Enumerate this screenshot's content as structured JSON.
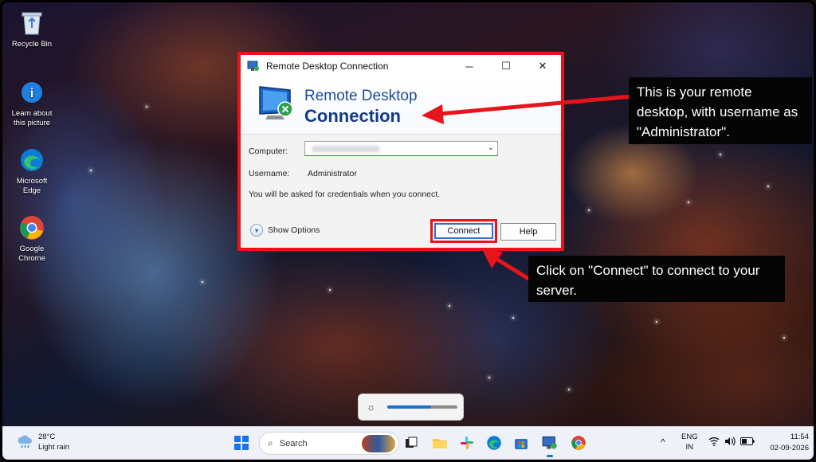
{
  "desktop": {
    "icons": [
      {
        "label": "Recycle Bin",
        "icon": "recycle-bin-icon"
      },
      {
        "label": "Learn about this picture",
        "icon": "learn-about-picture-icon"
      },
      {
        "label": "Microsoft Edge",
        "icon": "edge-icon"
      },
      {
        "label": "Google Chrome",
        "icon": "chrome-icon"
      }
    ]
  },
  "rdp_window": {
    "title": "Remote Desktop Connection",
    "banner_line1": "Remote Desktop",
    "banner_line2": "Connection",
    "computer_label": "Computer:",
    "computer_value": "",
    "username_label": "Username:",
    "username_value": "Administrator",
    "note": "You will be asked for credentials when you connect.",
    "show_options": "Show Options",
    "connect": "Connect",
    "help": "Help",
    "controls": [
      "minimize-icon",
      "maximize-icon",
      "close-icon"
    ],
    "highlight_color": "#e8141b"
  },
  "callouts": {
    "remote": "This is your remote desktop, with username as \"Administrator\".",
    "connect": "Click on \"Connect\" to connect to your server."
  },
  "brightness": {
    "level": 0.62,
    "icon": "sun-icon"
  },
  "taskbar": {
    "weather_temp": "28°C",
    "weather_desc": "Light rain",
    "search_placeholder": "Search",
    "apps": [
      "start-icon",
      "task-view-icon",
      "file-explorer-icon",
      "slack-icon",
      "edge-icon",
      "microsoft-store-icon",
      "remote-desktop-icon",
      "chrome-icon"
    ],
    "language_line1": "ENG",
    "language_line2": "IN",
    "time": "11:54",
    "date": "02-09-2026"
  }
}
